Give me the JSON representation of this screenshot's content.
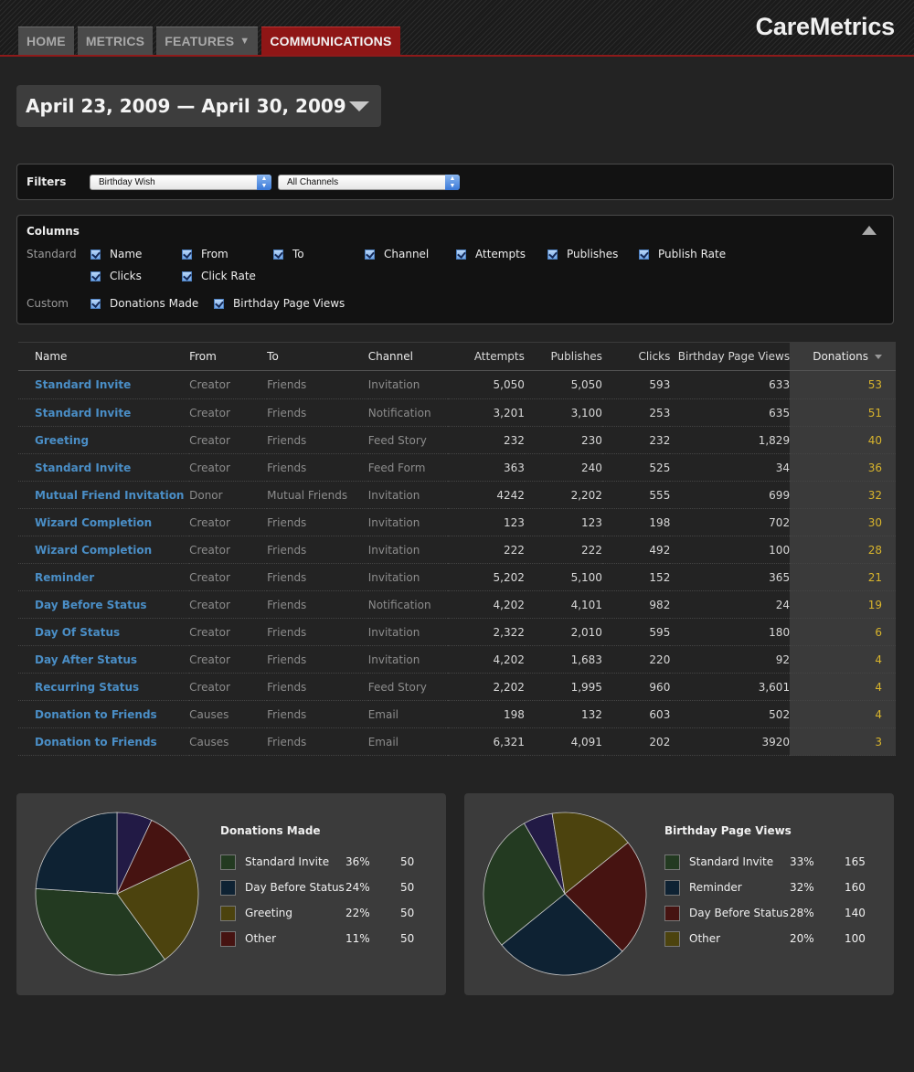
{
  "nav": {
    "tabs": [
      {
        "label": "HOME"
      },
      {
        "label": "METRICS"
      },
      {
        "label": "FEATURES",
        "caret": "▼"
      },
      {
        "label": "COMMUNICATIONS"
      }
    ],
    "brand": "CareMetrics"
  },
  "daterange": {
    "label": "April 23, 2009 — April 30, 2009"
  },
  "filters": {
    "label": "Filters",
    "communication": "Birthday Wish",
    "channel": "All Channels"
  },
  "columns": {
    "title": "Columns",
    "standard_label": "Standard",
    "custom_label": "Custom",
    "standard": [
      "Name",
      "From",
      "To",
      "Channel",
      "Attempts",
      "Publishes",
      "Publish Rate",
      "Clicks",
      "Click Rate"
    ],
    "custom": [
      "Donations Made",
      "Birthday Page Views"
    ]
  },
  "table": {
    "headers": [
      "Name",
      "From",
      "To",
      "Channel",
      "Attempts",
      "Publishes",
      "Clicks",
      "Birthday Page Views",
      "Donations"
    ],
    "rows": [
      [
        "Standard Invite",
        "Creator",
        "Friends",
        "Invitation",
        "5,050",
        "5,050",
        "593",
        "633",
        "53"
      ],
      [
        "Standard Invite",
        "Creator",
        "Friends",
        "Notification",
        "3,201",
        "3,100",
        "253",
        "635",
        "51"
      ],
      [
        "Greeting",
        "Creator",
        "Friends",
        "Feed Story",
        "232",
        "230",
        "232",
        "1,829",
        "40"
      ],
      [
        "Standard Invite",
        "Creator",
        "Friends",
        "Feed Form",
        "363",
        "240",
        "525",
        "34",
        "36"
      ],
      [
        "Mutual Friend Invitation",
        "Donor",
        "Mutual Friends",
        "Invitation",
        "4242",
        "2,202",
        "555",
        "699",
        "32"
      ],
      [
        "Wizard Completion",
        "Creator",
        "Friends",
        "Invitation",
        "123",
        "123",
        "198",
        "702",
        "30"
      ],
      [
        "Wizard Completion",
        "Creator",
        "Friends",
        "Invitation",
        "222",
        "222",
        "492",
        "100",
        "28"
      ],
      [
        "Reminder",
        "Creator",
        "Friends",
        "Invitation",
        "5,202",
        "5,100",
        "152",
        "365",
        "21"
      ],
      [
        "Day Before Status",
        "Creator",
        "Friends",
        "Notification",
        "4,202",
        "4,101",
        "982",
        "24",
        "19"
      ],
      [
        "Day Of Status",
        "Creator",
        "Friends",
        "Invitation",
        "2,322",
        "2,010",
        "595",
        "180",
        "6"
      ],
      [
        "Day After Status",
        "Creator",
        "Friends",
        "Invitation",
        "4,202",
        "1,683",
        "220",
        "92",
        "4"
      ],
      [
        "Recurring Status",
        "Creator",
        "Friends",
        "Feed Story",
        "2,202",
        "1,995",
        "960",
        "3,601",
        "4"
      ],
      [
        "Donation to Friends",
        "Causes",
        "Friends",
        "Email",
        "198",
        "132",
        "603",
        "502",
        "4"
      ],
      [
        "Donation to Friends",
        "Causes",
        "Friends",
        "Email",
        "6,321",
        "4,091",
        "202",
        "3920",
        "3"
      ]
    ]
  },
  "chart_data": [
    {
      "type": "pie",
      "title": "Donations Made",
      "slices": [
        {
          "label": "Standard Invite",
          "pct": "36%",
          "value": "50",
          "color": "#233a21",
          "share": 0.36
        },
        {
          "label": "Day Before Status",
          "pct": "24%",
          "value": "50",
          "color": "#0e2233",
          "share": 0.24
        },
        {
          "label": "Greeting",
          "pct": "22%",
          "value": "50",
          "color": "#4c430e",
          "share": 0.22
        },
        {
          "label": "Other",
          "pct": "11%",
          "value": "50",
          "color": "#461311",
          "share": 0.11
        }
      ],
      "extra_slice": {
        "color": "#221a45",
        "share": 0.07
      }
    },
    {
      "type": "pie",
      "title": "Birthday Page Views",
      "slices": [
        {
          "label": "Standard Invite",
          "pct": "33%",
          "value": "165",
          "color": "#233a21",
          "share": 0.33
        },
        {
          "label": "Reminder",
          "pct": "32%",
          "value": "160",
          "color": "#0e2233",
          "share": 0.32
        },
        {
          "label": "Day Before Status",
          "pct": "28%",
          "value": "140",
          "color": "#461311",
          "share": 0.28
        },
        {
          "label": "Other",
          "pct": "20%",
          "value": "100",
          "color": "#4c430e",
          "share": 0.2
        }
      ],
      "extra_slice": {
        "color": "#221a45",
        "share": 0.07
      }
    }
  ]
}
